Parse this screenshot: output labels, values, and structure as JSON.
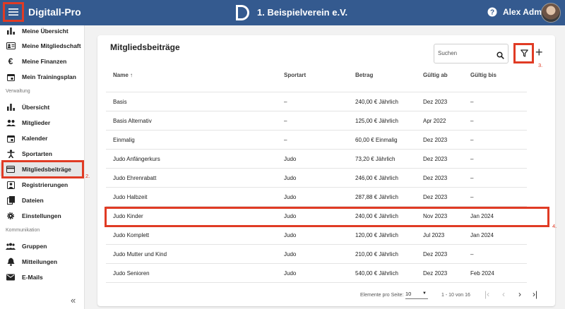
{
  "topbar": {
    "app_title": "Digitall-Pro",
    "club_name": "1. Beispielverein e.V.",
    "user_name": "Alex Admin",
    "menu_icon": "menu-icon",
    "help_icon": "help-icon",
    "brand_color": "#345a8f"
  },
  "sidebar": {
    "items_top": [
      {
        "label": "Meine Übersicht",
        "icon": "bar-chart-icon"
      },
      {
        "label": "Meine Mitgliedschaft",
        "icon": "id-card-icon"
      },
      {
        "label": "Meine Finanzen",
        "icon": "euro-icon"
      },
      {
        "label": "Mein Trainingsplan",
        "icon": "calendar-icon"
      }
    ],
    "section_admin": "Verwaltung",
    "items_admin": [
      {
        "label": "Übersicht",
        "icon": "bar-chart-icon"
      },
      {
        "label": "Mitglieder",
        "icon": "people-icon"
      },
      {
        "label": "Kalender",
        "icon": "calendar-icon"
      },
      {
        "label": "Sportarten",
        "icon": "sport-icon"
      },
      {
        "label": "Mitgliedsbeiträge",
        "icon": "credit-card-icon"
      },
      {
        "label": "Registrierungen",
        "icon": "person-card-icon"
      },
      {
        "label": "Dateien",
        "icon": "files-icon"
      },
      {
        "label": "Einstellungen",
        "icon": "gear-icon"
      }
    ],
    "section_comm": "Kommunikation",
    "items_comm": [
      {
        "label": "Gruppen",
        "icon": "groups-icon"
      },
      {
        "label": "Mitteilungen",
        "icon": "bell-icon"
      },
      {
        "label": "E-Mails",
        "icon": "mail-icon"
      }
    ],
    "collapse_glyph": "«"
  },
  "annotations": {
    "n2": "2.",
    "n3": "3.",
    "n4": "4.",
    "color": "#e03b24"
  },
  "main": {
    "title": "Mitgliedsbeiträge",
    "search_placeholder": "Suchen",
    "columns": [
      "Name ↑",
      "Sportart",
      "Betrag",
      "Gültig ab",
      "Gültig bis"
    ],
    "rows": [
      [
        "Basis",
        "–",
        "240,00 € Jährlich",
        "Dez 2023",
        "–"
      ],
      [
        "Basis Alternativ",
        "–",
        "125,00 € Jährlich",
        "Apr 2022",
        "–"
      ],
      [
        "Einmalig",
        "–",
        "60,00 € Einmalig",
        "Dez 2023",
        "–"
      ],
      [
        "Judo Anfängerkurs",
        "Judo",
        "73,20 € Jährlich",
        "Dez 2023",
        "–"
      ],
      [
        "Judo Ehrenrabatt",
        "Judo",
        "246,00 € Jährlich",
        "Dez 2023",
        "–"
      ],
      [
        "Judo Halbzeit",
        "Judo",
        "287,88 € Jährlich",
        "Dez 2023",
        "–"
      ],
      [
        "Judo Kinder",
        "Judo",
        "240,00 € Jährlich",
        "Nov 2023",
        "Jan 2024"
      ],
      [
        "Judo Komplett",
        "Judo",
        "120,00 € Jährlich",
        "Jul 2023",
        "Jan 2024"
      ],
      [
        "Judo Mutter und Kind",
        "Judo",
        "210,00 € Jährlich",
        "Dez 2023",
        "–"
      ],
      [
        "Judo Senioren",
        "Judo",
        "540,00 € Jährlich",
        "Dez 2023",
        "Feb 2024"
      ]
    ],
    "pagination": {
      "label": "Elemente pro Seite:",
      "page_size": "10",
      "range": "1 - 10 von 16"
    }
  }
}
